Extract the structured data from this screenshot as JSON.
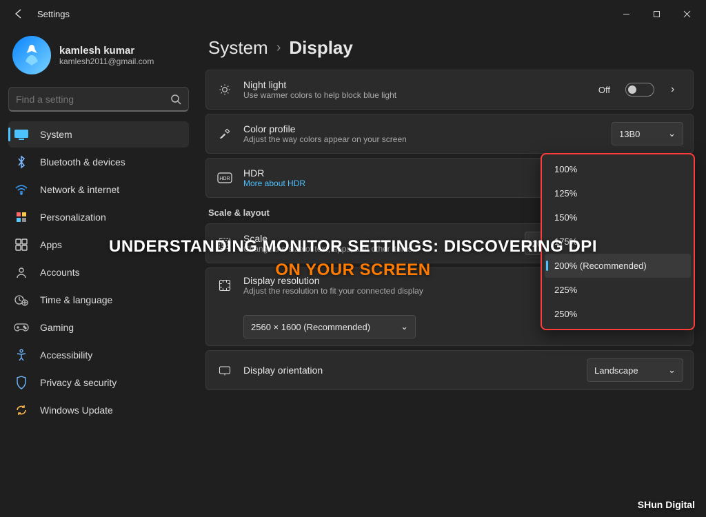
{
  "window": {
    "title": "Settings"
  },
  "user": {
    "name": "kamlesh kumar",
    "email": "kamlesh2011@gmail.com"
  },
  "search": {
    "placeholder": "Find a setting"
  },
  "nav": {
    "items": [
      {
        "label": "System",
        "icon": "monitor-icon",
        "selected": true
      },
      {
        "label": "Bluetooth & devices",
        "icon": "bluetooth-icon",
        "selected": false
      },
      {
        "label": "Network & internet",
        "icon": "wifi-icon",
        "selected": false
      },
      {
        "label": "Personalization",
        "icon": "paint-icon",
        "selected": false
      },
      {
        "label": "Apps",
        "icon": "apps-icon",
        "selected": false
      },
      {
        "label": "Accounts",
        "icon": "person-icon",
        "selected": false
      },
      {
        "label": "Time & language",
        "icon": "clock-globe-icon",
        "selected": false
      },
      {
        "label": "Gaming",
        "icon": "gamepad-icon",
        "selected": false
      },
      {
        "label": "Accessibility",
        "icon": "accessibility-icon",
        "selected": false
      },
      {
        "label": "Privacy & security",
        "icon": "shield-icon",
        "selected": false
      },
      {
        "label": "Windows Update",
        "icon": "update-icon",
        "selected": false
      }
    ]
  },
  "breadcrumb": {
    "root": "System",
    "leaf": "Display"
  },
  "night_light": {
    "title": "Night light",
    "sub": "Use warmer colors to help block blue light",
    "state": "Off"
  },
  "color_profile": {
    "title": "Color profile",
    "sub": "Adjust the way colors appear on your screen",
    "value": "13B0"
  },
  "hdr": {
    "title": "HDR",
    "sub": "More about HDR"
  },
  "section_scale": "Scale & layout",
  "scale": {
    "title": "Scale",
    "sub": "Change the size of text, apps, and other items",
    "value": "200% (Recommended)"
  },
  "scale_options": [
    "100%",
    "125%",
    "150%",
    "175%",
    "200% (Recommended)",
    "225%",
    "250%"
  ],
  "resolution": {
    "title": "Display resolution",
    "sub": "Adjust the resolution to fit your connected display",
    "value": "2560 × 1600 (Recommended)"
  },
  "orientation": {
    "title": "Display orientation",
    "value": "Landscape"
  },
  "overlay": {
    "line1": "UNDERSTANDING MONITOR SETTINGS: DISCOVERING DPI",
    "line2": "ON YOUR SCREEN"
  },
  "watermark": "SHun Digital"
}
